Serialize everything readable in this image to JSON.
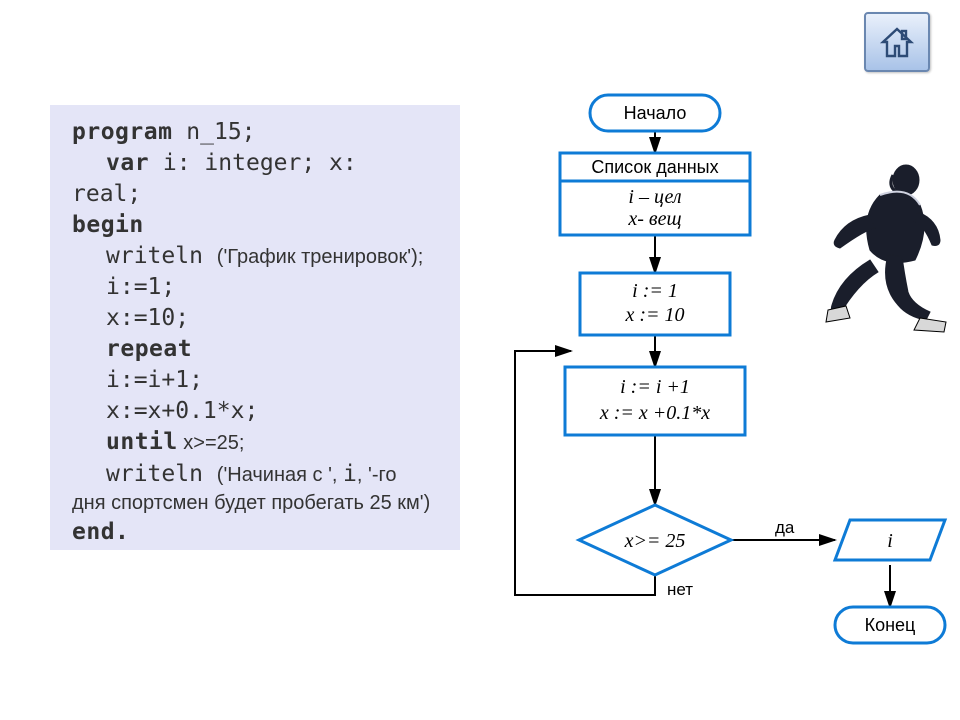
{
  "home_button": {
    "aria": "home"
  },
  "code": {
    "program_kw": "program",
    "program_name": " n_15;",
    "var_kw": "var",
    "var_decl": " i: integer; x:",
    "real_line": "real;",
    "begin_kw": "begin",
    "writeln1_pre": "writeln ",
    "writeln1_arg": "('График тренировок');",
    "assign_i1": "i:=1;",
    "assign_x10": "x:=10;",
    "repeat_kw": "repeat",
    "inc_i": "i:=i+1;",
    "inc_x": "x:=x+0.1*x;",
    "until_kw": "until",
    "until_cond": " x>=25;",
    "writeln2_pre": "writeln ",
    "writeln2_arg1": "('Начиная с ', ",
    "writeln2_i": "i",
    "writeln2_arg2": ", '-го",
    "writeln2_line2": "дня спортсмен будет пробегать 25 км')",
    "end_kw": "end."
  },
  "flow": {
    "start": "Начало",
    "data_title": "Список данных",
    "data_i": "i – цел",
    "data_x": "x- вещ",
    "init_i": "i := 1",
    "init_x": "x := 10",
    "loop_i": "i := i +1",
    "loop_x": "x := x +0.1*x",
    "cond": "x>= 25",
    "yes": "да",
    "no": "нет",
    "output": "i",
    "end": "Конец"
  }
}
